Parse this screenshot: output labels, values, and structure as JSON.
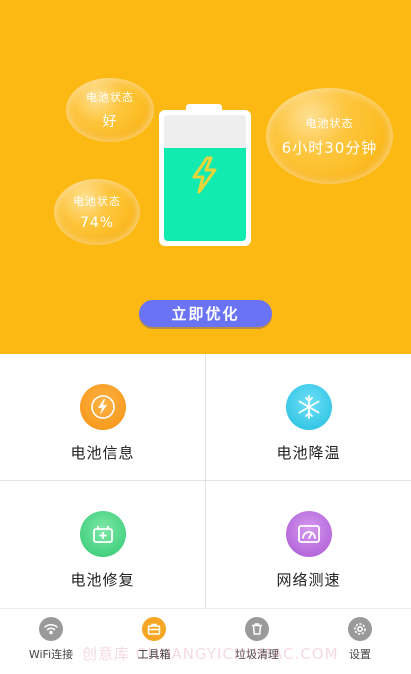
{
  "battery_status": {
    "bubbles": [
      {
        "label": "电池状态",
        "value": "好"
      },
      {
        "label": "电池状态",
        "value": "74%"
      },
      {
        "label": "电池状态",
        "value": "6小时30分钟"
      }
    ],
    "level_fraction": 0.74,
    "optimize_label": "立即优化"
  },
  "tools": [
    {
      "label": "电池信息",
      "icon": "battery-bolt-icon",
      "color": "#f4920e"
    },
    {
      "label": "电池降温",
      "icon": "snowflake-icon",
      "color": "#27c6e6"
    },
    {
      "label": "电池修复",
      "icon": "battery-repair-icon",
      "color": "#37d07a"
    },
    {
      "label": "网络测速",
      "icon": "speedometer-icon",
      "color": "#b566d8"
    }
  ],
  "tabbar": {
    "items": [
      {
        "label": "WiFi连接",
        "icon": "wifi-icon"
      },
      {
        "label": "工具箱",
        "icon": "toolbox-icon",
        "active": true
      },
      {
        "label": "垃圾清理",
        "icon": "trash-icon"
      },
      {
        "label": "设置",
        "icon": "gear-icon"
      }
    ]
  },
  "colors": {
    "hero_bg": "#fdb913",
    "battery_fill": "#12ebb0",
    "button": "#6b73f5",
    "tab_active": "#f5a623",
    "tab_inactive": "#9a9a9a"
  },
  "watermark": "创意库 CHUANGYICHUMAC.COM"
}
